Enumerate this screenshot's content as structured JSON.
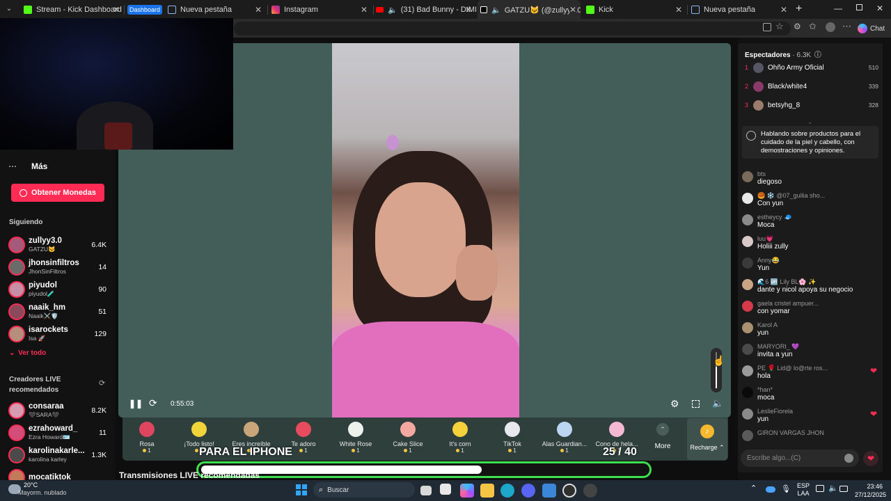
{
  "browser": {
    "tabs": [
      {
        "title": "Stream - Kick Dashboard",
        "favicon_color": "#53fc18"
      },
      {
        "title": "Nueva pestaña",
        "group_label": "Dashboard",
        "favicon_color": "#8ab4f8"
      },
      {
        "title": "Instagram",
        "favicon_color": "#e1306c"
      },
      {
        "title": "(31) Bad Bunny - DtMF (Vid",
        "favicon_color": "#ff0000"
      },
      {
        "title": "GATZU🐱 (@zullyy3.0) est",
        "favicon_color": "#ffffff"
      },
      {
        "title": "Kick",
        "favicon_color": "#53fc18"
      },
      {
        "title": "Nueva pestaña",
        "favicon_color": "#8ab4f8"
      }
    ],
    "new_tab_icon": "plus-icon",
    "chat_button_label": "Chat",
    "window_controls": [
      "minimize-icon",
      "restore-icon",
      "close-icon"
    ]
  },
  "sidebar": {
    "more_label": "Más",
    "coins_button_label": "Obtener Monedas",
    "following_title": "Siguiendo",
    "following": [
      {
        "name": "zullyy3.0",
        "sub": "GATZU🐱",
        "count": "6.4K",
        "avatar_color": "#a45a7a"
      },
      {
        "name": "jhonsinfiltros",
        "sub": "JhonSinFiltros",
        "count": "14",
        "avatar_color": "#6b6b6b"
      },
      {
        "name": "piyudol",
        "sub": "piyudol🧪",
        "count": "90",
        "avatar_color": "#c78fa5"
      },
      {
        "name": "naaik_hm",
        "sub": "Naaik⚔️🛡️",
        "count": "51",
        "avatar_color": "#8a4a5a"
      },
      {
        "name": "isarockets",
        "sub": "Isa 🚀",
        "count": "129",
        "avatar_color": "#b58f7c"
      }
    ],
    "see_all_label": "Ver todo",
    "recommended_title": "Creadores LIVE recomendados",
    "recommended": [
      {
        "name": "consaraa",
        "sub": "🖤SARA🖤",
        "count": "8.2K",
        "avatar_color": "#d59bb0"
      },
      {
        "name": "ezrahoward_",
        "sub": "Ezra Howard🪪",
        "count": "11",
        "avatar_color": "#d44d7a"
      },
      {
        "name": "karolinakarle...",
        "sub": "karolina karley",
        "count": "1.3K",
        "avatar_color": "#4a4a4a"
      },
      {
        "name": "mocatiktok",
        "sub": "",
        "count": "",
        "avatar_color": "#c27a58"
      }
    ]
  },
  "main": {
    "bottom_heading": "Transmisiones LIVE recomendadas",
    "player": {
      "time": "0:55:03",
      "volume_fraction": 0.6
    },
    "overlay": {
      "caption": "PARA EL IPHONE",
      "counter": "25 / 40",
      "progress_fraction": 0.63
    },
    "gifts": [
      {
        "label": "Rosa",
        "cost": "1",
        "color": "#e0455f"
      },
      {
        "label": "¡Todo listo!",
        "cost": "1",
        "color": "#f0d43a"
      },
      {
        "label": "Eres increíble",
        "cost": "1",
        "color": "#c9a57a"
      },
      {
        "label": "Te adoro",
        "cost": "1",
        "color": "#e74c5e"
      },
      {
        "label": "White Rose",
        "cost": "1",
        "color": "#eef2ec"
      },
      {
        "label": "Cake Slice",
        "cost": "1",
        "color": "#f4a9a0"
      },
      {
        "label": "It's corn",
        "cost": "1",
        "color": "#f5d23b"
      },
      {
        "label": "TikTok",
        "cost": "1",
        "color": "#e8e8f0"
      },
      {
        "label": "Alas Guardian...",
        "cost": "1",
        "color": "#bcd6f2"
      },
      {
        "label": "Cono de hela...",
        "cost": "1",
        "color": "#f4b8d3"
      }
    ],
    "gifts_more_label": "More",
    "recharge_label": "Recharge"
  },
  "chat": {
    "viewers_title": "Espectadores",
    "viewers_count": "· 6.3K",
    "top_viewers": [
      {
        "rank": "1",
        "name": "Ohño Army Oficial",
        "score": "510",
        "avatar_color": "#556"
      },
      {
        "rank": "2",
        "name": "Black/white4",
        "score": "339",
        "avatar_color": "#8a3a6a"
      },
      {
        "rank": "3",
        "name": "betsyhg_8",
        "score": "328",
        "avatar_color": "#9b7b6b"
      }
    ],
    "pinned_text": "Hablando sobre productos para el cuidado de la piel y cabello, con demostraciones y opiniones.",
    "messages": [
      {
        "user": "bts",
        "text": "diegoso",
        "avatar_color": "#7a6a5a",
        "heart": false
      },
      {
        "user": "🥮 ❄️ @07_guilia sho...",
        "text": "Con yun",
        "avatar_color": "#e8e8e8",
        "heart": false
      },
      {
        "user": "estheycy 🧢",
        "text": "Moca",
        "avatar_color": "#8a8a8a",
        "heart": false
      },
      {
        "user": "luu💗",
        "text": "Holiii zully",
        "avatar_color": "#d8c8c8",
        "heart": false
      },
      {
        "user": "Anny😂",
        "text": "Yun",
        "avatar_color": "#3a3a3a",
        "heart": false
      },
      {
        "user": "🌊6 🆙 Lily BL🌸 ✨",
        "text": "dante y nicol apoya su negocio",
        "avatar_color": "#c9a585",
        "heart": false
      },
      {
        "user": "gaela cristel ampuer...",
        "text": "con yomar",
        "avatar_color": "#d43a4a",
        "heart": false
      },
      {
        "user": "Karol A",
        "text": "yun",
        "avatar_color": "#a89070",
        "heart": false
      },
      {
        "user": "MARYORI_ 💜",
        "text": "invita a yun",
        "avatar_color": "#4a4a4a",
        "heart": false
      },
      {
        "user": "PE 🌹 Lid@ lo@rte ros...",
        "text": "hola",
        "avatar_color": "#9a9a9a",
        "heart": true
      },
      {
        "user": "*han*",
        "text": "moca",
        "avatar_color": "#0a0a0a",
        "heart": false
      },
      {
        "user": "LeslieFiorela",
        "text": "yun",
        "avatar_color": "#8a8a8a",
        "heart": true
      },
      {
        "user": "GIRON VARGAS JHON",
        "text": "",
        "avatar_color": "#5a5a5a",
        "heart": false
      }
    ],
    "input_placeholder": "Escribe algo...(C)"
  },
  "taskbar": {
    "weather_temp": "20°C",
    "weather_desc": "Mayorm. nublado",
    "search_label": "Buscar",
    "lang_top": "ESP",
    "lang_bottom": "LAA",
    "time": "23:46",
    "date": "27/12/2025"
  }
}
